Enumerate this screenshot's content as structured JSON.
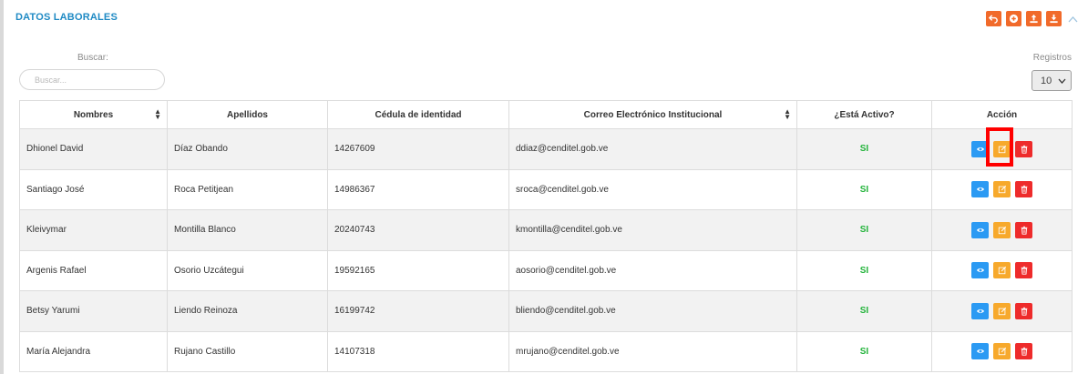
{
  "section": {
    "title": "DATOS LABORALES"
  },
  "header_icons": [
    "undo-icon",
    "add-circle-icon",
    "upload-icon",
    "download-icon",
    "chevron-up-icon"
  ],
  "search": {
    "label": "Buscar:",
    "placeholder": "Buscar...",
    "value": ""
  },
  "records": {
    "label": "Registros",
    "selected": "10"
  },
  "table": {
    "columns": [
      "Nombres",
      "Apellidos",
      "Cédula de identidad",
      "Correo Electrónico Institucional",
      "¿Está Activo?",
      "Acción"
    ],
    "rows": [
      {
        "nombres": "Dhionel David",
        "apellidos": "Díaz Obando",
        "cedula": "14267609",
        "correo": "ddiaz@cenditel.gob.ve",
        "activo": "SI"
      },
      {
        "nombres": "Santiago José",
        "apellidos": "Roca Petitjean",
        "cedula": "14986367",
        "correo": "sroca@cenditel.gob.ve",
        "activo": "SI"
      },
      {
        "nombres": "Kleivymar",
        "apellidos": "Montilla Blanco",
        "cedula": "20240743",
        "correo": "kmontilla@cenditel.gob.ve",
        "activo": "SI"
      },
      {
        "nombres": "Argenis Rafael",
        "apellidos": "Osorio Uzcátegui",
        "cedula": "19592165",
        "correo": "aosorio@cenditel.gob.ve",
        "activo": "SI"
      },
      {
        "nombres": "Betsy Yarumi",
        "apellidos": "Liendo Reinoza",
        "cedula": "16199742",
        "correo": "bliendo@cenditel.gob.ve",
        "activo": "SI"
      },
      {
        "nombres": "María Alejandra",
        "apellidos": "Rujano Castillo",
        "cedula": "14107318",
        "correo": "mrujano@cenditel.gob.ve",
        "activo": "SI"
      }
    ]
  },
  "colors": {
    "title": "#1f8ac4",
    "header_buttons": "#f16a2a",
    "view": "#2b9af3",
    "edit": "#f7a92c",
    "delete": "#ee2b2b",
    "active": "#22b33a",
    "highlight": "#ff0000"
  },
  "action_icons": [
    "eye-icon",
    "edit-icon",
    "trash-icon"
  ]
}
